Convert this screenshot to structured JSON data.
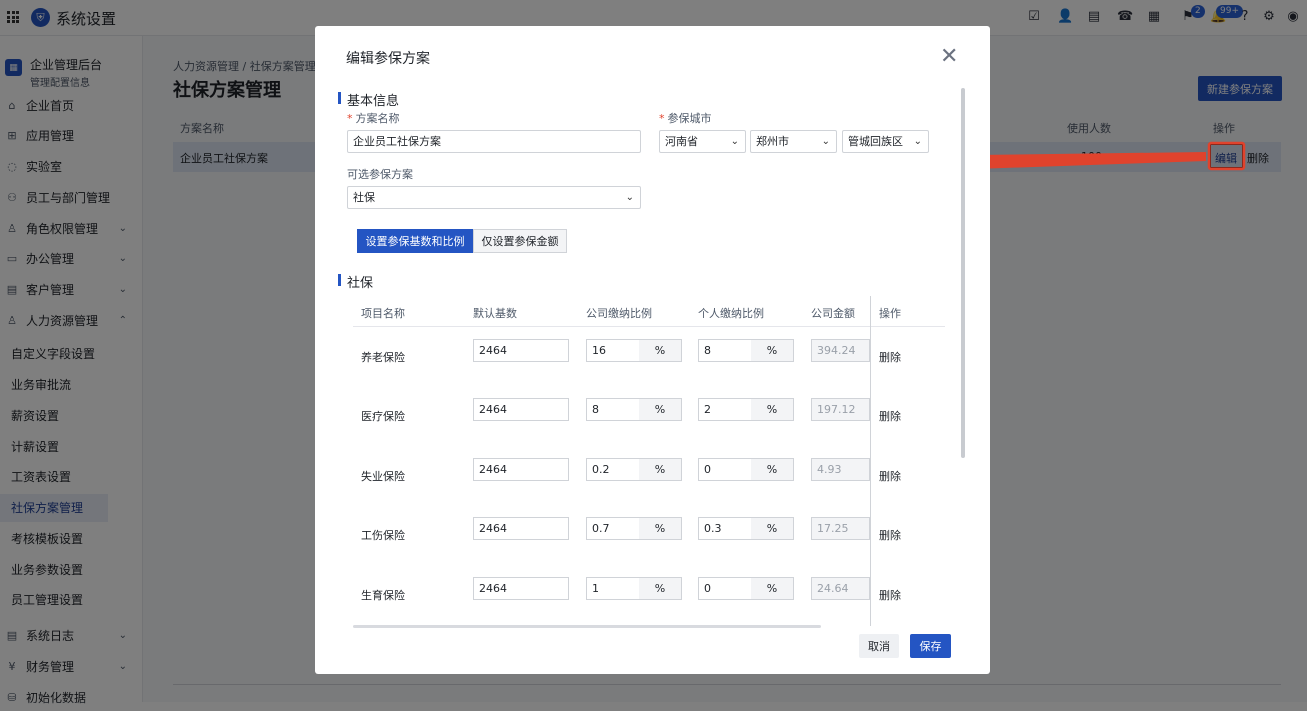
{
  "app": {
    "title": "系统设置",
    "logo_icon": "shield-logo-icon"
  },
  "topbar": {
    "icons": [
      "check-square-icon",
      "user-icon",
      "document-icon",
      "phone-icon",
      "calendar-icon",
      "flag-icon",
      "bell-icon",
      "help-icon",
      "gear-icon",
      "account-icon"
    ],
    "flag_badge": "2",
    "bell_badge": "99+"
  },
  "sidebar": {
    "org_name": "企业管理后台",
    "org_sub": "管理配置信息",
    "items": [
      {
        "label": "企业首页",
        "icon": "home-icon"
      },
      {
        "label": "应用管理",
        "icon": "apps-icon"
      },
      {
        "label": "实验室",
        "icon": "lightbulb-icon"
      },
      {
        "label": "员工与部门管理",
        "icon": "people-icon"
      },
      {
        "label": "角色权限管理",
        "icon": "role-icon"
      },
      {
        "label": "办公管理",
        "icon": "briefcase-icon"
      },
      {
        "label": "客户管理",
        "icon": "contacts-icon"
      },
      {
        "label": "人力资源管理",
        "icon": "person-icon"
      }
    ],
    "subitems": [
      "自定义字段设置",
      "业务审批流",
      "薪资设置",
      "计薪设置",
      "工资表设置",
      "社保方案管理",
      "考核模板设置",
      "业务参数设置",
      "员工管理设置"
    ],
    "bottom_items": [
      {
        "label": "系统日志",
        "icon": "log-icon"
      },
      {
        "label": "财务管理",
        "icon": "finance-icon"
      },
      {
        "label": "初始化数据",
        "icon": "data-icon"
      }
    ]
  },
  "page": {
    "breadcrumb": "人力资源管理  /  社保方案管理",
    "title": "社保方案管理",
    "new_button": "新建参保方案",
    "columns": {
      "name": "方案名称",
      "count": "使用人数",
      "ops": "操作"
    },
    "row": {
      "name": "企业员工社保方案",
      "count": "100",
      "edit": "编辑",
      "delete": "删除"
    }
  },
  "modal": {
    "title": "编辑参保方案",
    "section_basic": "基本信息",
    "label_name": "方案名称",
    "name_value": "企业员工社保方案",
    "label_city": "参保城市",
    "province": "河南省",
    "city": "郑州市",
    "district": "管城回族区",
    "label_optional": "可选参保方案",
    "optional_value": "社保",
    "seg_1": "设置参保基数和比例",
    "seg_2": "仅设置参保金额",
    "section_social": "社保",
    "table_headers": {
      "item": "项目名称",
      "base": "默认基数",
      "company_rate": "公司缴纳比例",
      "personal_rate": "个人缴纳比例",
      "company_amount": "公司金额",
      "ops": "操作"
    },
    "pct_symbol": "%",
    "rows": [
      {
        "name": "养老保险",
        "base": "2464",
        "company_rate": "16",
        "personal_rate": "8",
        "company_amount": "394.24",
        "op": "删除"
      },
      {
        "name": "医疗保险",
        "base": "2464",
        "company_rate": "8",
        "personal_rate": "2",
        "company_amount": "197.12",
        "op": "删除"
      },
      {
        "name": "失业保险",
        "base": "2464",
        "company_rate": "0.2",
        "personal_rate": "0",
        "company_amount": "4.93",
        "op": "删除"
      },
      {
        "name": "工伤保险",
        "base": "2464",
        "company_rate": "0.7",
        "personal_rate": "0.3",
        "company_amount": "17.25",
        "op": "删除"
      },
      {
        "name": "生育保险",
        "base": "2464",
        "company_rate": "1",
        "personal_rate": "0",
        "company_amount": "24.64",
        "op": "删除"
      }
    ],
    "cancel": "取消",
    "save": "保存",
    "close_icon": "close-icon"
  },
  "colors": {
    "primary": "#2455c3",
    "highlight": "#e0432d",
    "selected_row": "#dce4f2"
  }
}
